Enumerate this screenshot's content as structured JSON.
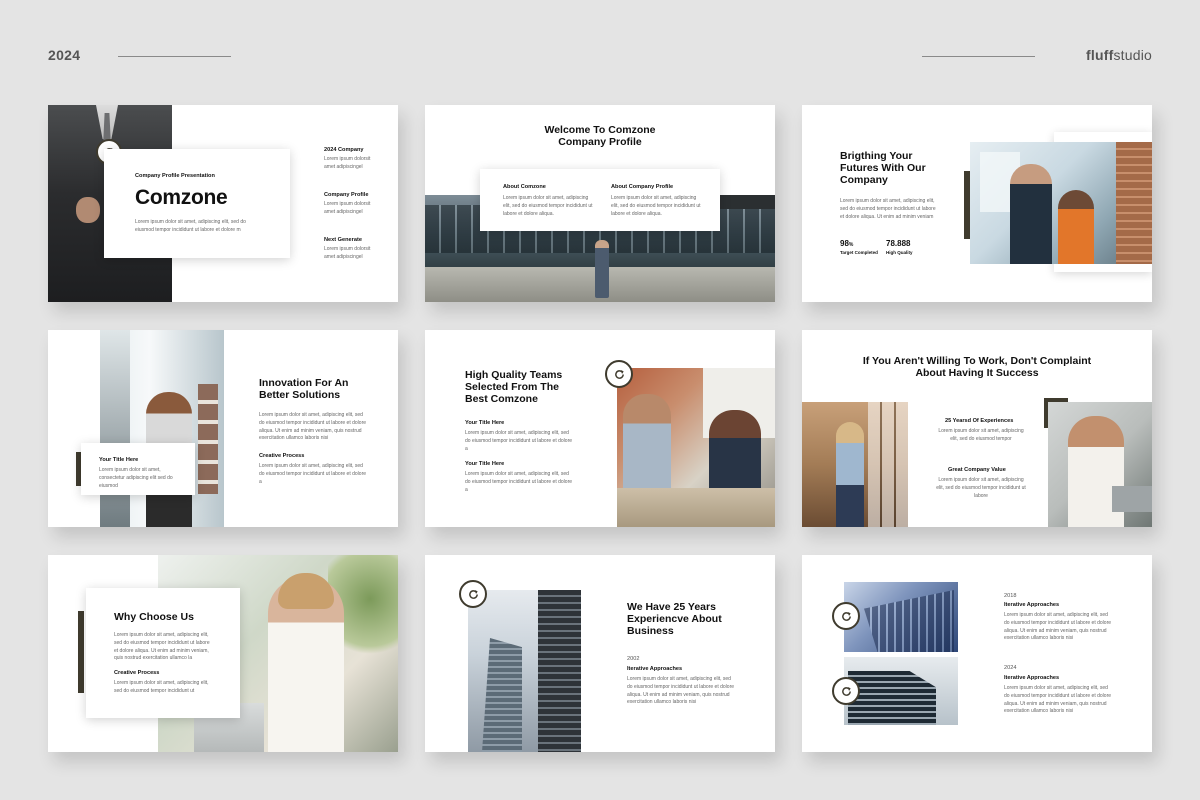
{
  "header": {
    "year": "2024",
    "brand_bold": "fluff",
    "brand_rest": "studio"
  },
  "colors": {
    "accent": "#3f3b2e",
    "background": "#e4e4e4"
  },
  "lorem": {
    "two_line": "Lorem ipsum dolor sit amet, adipiscing elit, sed do eiusmod tempor.",
    "long": "Lorem ipsum dolor sit amet, adipiscing elit, sed do eiusmod tempor incididunt ut labore et dolore aliqua. Ut enim ad minim veniam, quis nostrud exercitation ullamco laboris nisi"
  },
  "s1": {
    "subtitle": "Company Profile Presentation",
    "title": "Comzone",
    "desc": "Lorem ipsum dolor sit amet, adipiscing elit, sed do eiusmod tempor incididunt ut labore et dolore m",
    "items": [
      {
        "title": "2024 Company",
        "text": "Lorem ipsum dolorsit amet adipiscingel"
      },
      {
        "title": "Company Profile",
        "text": "Lorem ipsum dolorsit amet adipiscingel"
      },
      {
        "title": "Next Generate",
        "text": "Lorem ipsum dolorsit amet adipiscingel"
      }
    ]
  },
  "s2": {
    "title": "Welcome To Comzone Company Profile",
    "col1_title": "About Comzone",
    "col1_text": "Lorem ipsum dolor sit amet, adipiscing elit, sed do eiusmod tempor incididunt ut labore et dolore aliqua.",
    "col2_title": "About Company Profile",
    "col2_text": "Lorem ipsum dolor sit amet, adipiscing elit, sed do eiusmod tempor incididunt ut labore et dolore aliqua."
  },
  "s3": {
    "title": "Brigthing Your Futures With Our Company",
    "text": "Lorem ipsum dolor sit amet, adipiscing elit, sed do eiusmod tempor incididunt ut labore et dolore aliqua. Ut enim ad minim veniam",
    "stat1_value": "98",
    "stat1_unit": "%",
    "stat1_label": "Target Completed",
    "stat2_value": "78.888",
    "stat2_label": "High Quality"
  },
  "s4": {
    "title": "Innovation For An Better Solutions",
    "text": "Lorem ipsum dolor sit amet, adipiscing elit, sed do eiusmod tempor incididunt ut labore et dolore aliqua. Ut enim ad minim veniam, quis nostrud exercitation ullamco laboris nisi",
    "card_title": "Your Title Here",
    "card_text": "Lorem ipsum dolor sit amet, consectetur adipiscing elit sed do eiusmod",
    "sub_title": "Creative Process",
    "sub_text": "Lorem ipsum dolor sit amet, adipiscing elit, sed do eiusmod tempor incididunt ut labore et dolore a"
  },
  "s5": {
    "title": "High Quality Teams Selected From The Best Comzone",
    "item1_title": "Your Title Here",
    "item1_text": "Lorem ipsum dolor sit amet, adipiscing elit, sed do eiusmod tempor incididunt ut labore et dolore a",
    "item2_title": "Your Title Here",
    "item2_text": "Lorem ipsum dolor sit amet, adipiscing elit, sed do eiusmod tempor incididunt ut labore et dolore a"
  },
  "s6": {
    "title": "If You Aren't Willing To Work, Don't Complaint About Having It Success",
    "item1_title": "25 Yearsd Of Experiences",
    "item1_text": "Lorem ipsum dolor sit amet, adipiscing elit, sed do eiusmod tempor",
    "item2_title": "Great Company Value",
    "item2_text": "Lorem ipsum dolor sit amet, adipiscing elit, sed do eiusmod tempor incididunt ut labore"
  },
  "s7": {
    "title": "Why Choose Us",
    "text": "Lorem ipsum dolor sit amet, adipiscing elit, sed do eiusmod tempor incididunt ut labore et dolore aliqua. Ut enim ad minim veniam, quis nostrud exercitation ullamco la",
    "sub_title": "Creative Process",
    "sub_text": "Lorem ipsum dolor sit amet, adipiscing elit, sed do eiusmod tempor incididunt ut"
  },
  "s8": {
    "title": "We Have 25 Years Experiencve About Business",
    "year": "2002",
    "sub_title": "Iterative Approaches",
    "text": "Lorem ipsum dolor sit amet, adipiscing elit, sed do eiusmod tempor incididunt ut labore et dolore aliqua. Ut enim ad minim veniam, quis nostrud exercitation ullamco laboris nisi"
  },
  "s9": {
    "item1_year": "2018",
    "item1_title": "Iterative Approaches",
    "item1_text": "Lorem ipsum dolor sit amet, adipiscing elit, sed do eiusmod tempor incididunt ut labore et dolore aliqua. Ut enim ad minim veniam, quis nostrud exercitation ullamco laboris nisi",
    "item2_year": "2024",
    "item2_title": "Iterative Approaches",
    "item2_text": "Lorem ipsum dolor sit amet, adipiscing elit, sed do eiusmod tempor incididunt ut labore et dolore aliqua. Ut enim ad minim veniam, quis nostrud exercitation ullamco laboris nisi"
  }
}
